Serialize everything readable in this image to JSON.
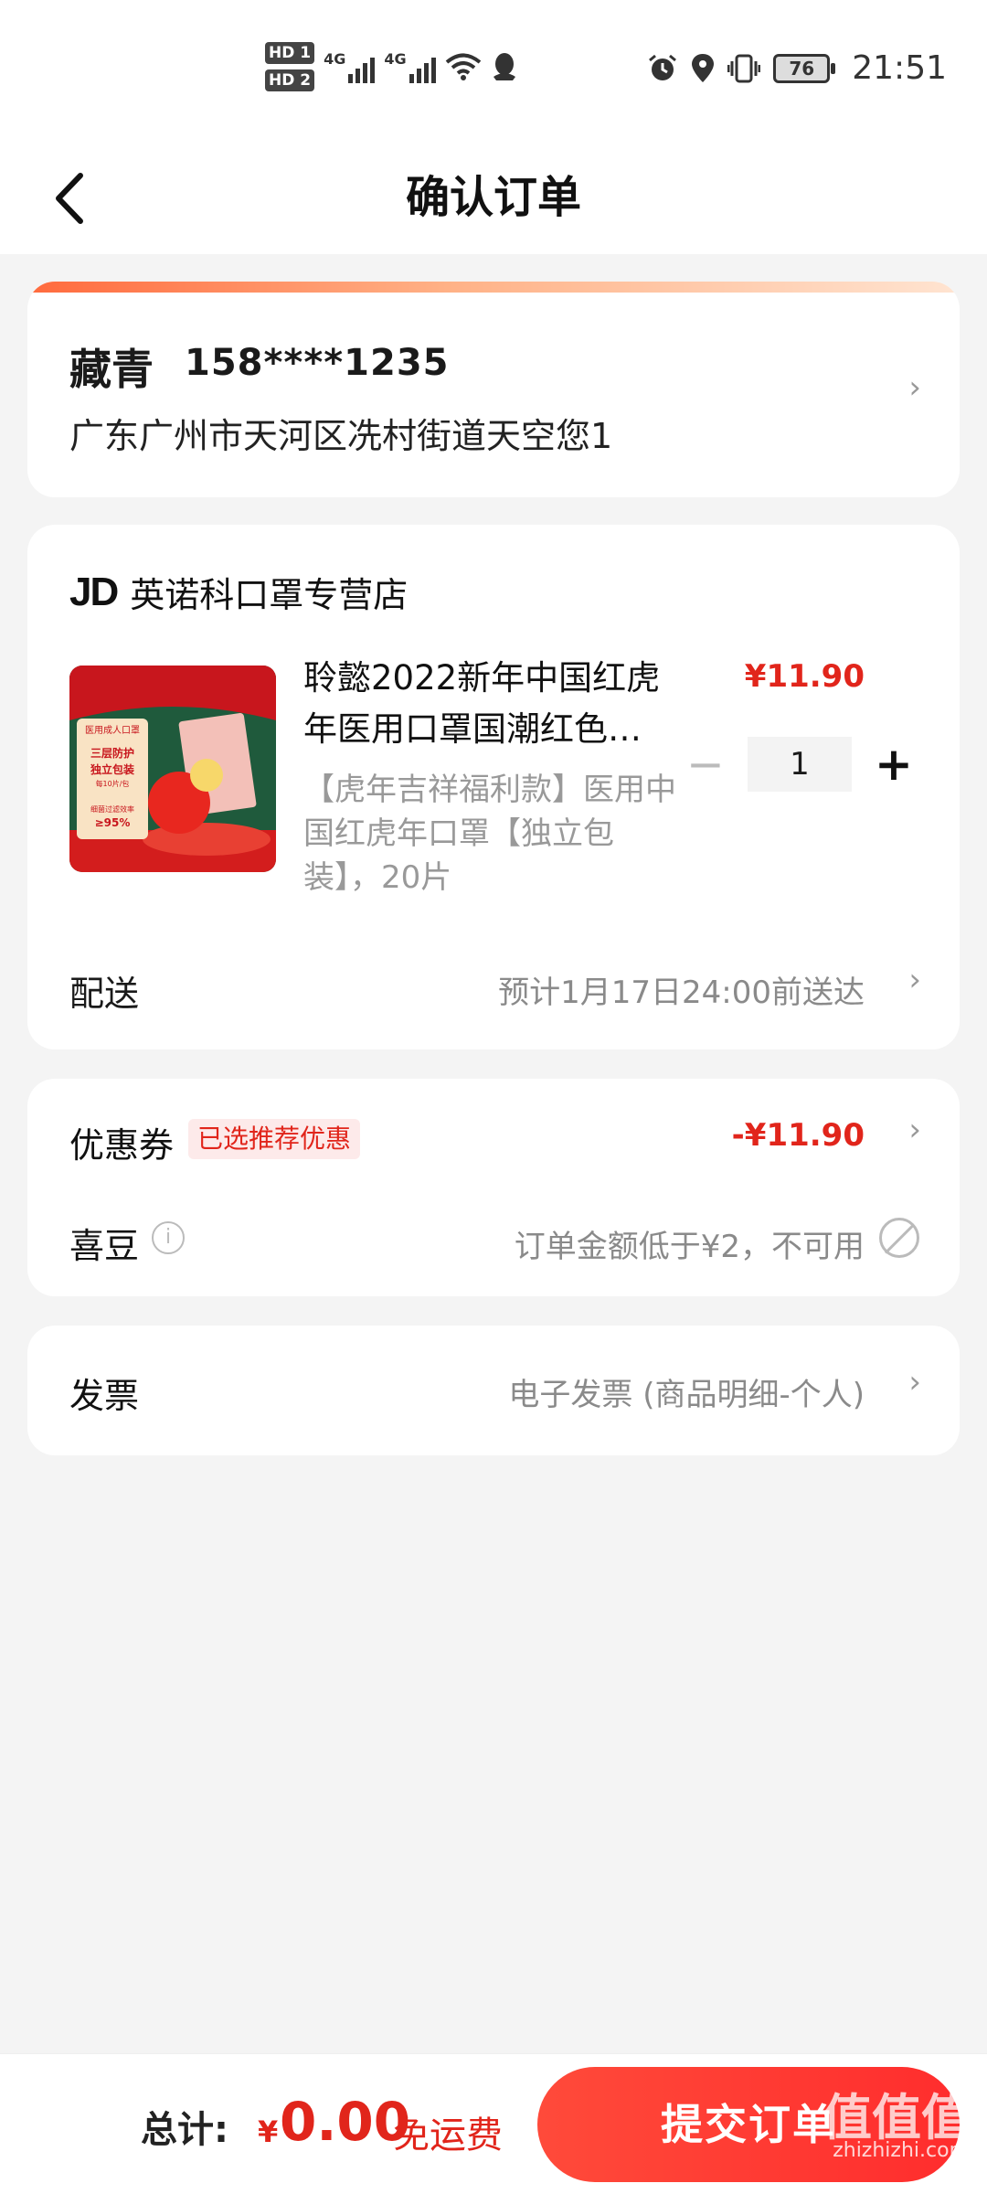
{
  "status_bar": {
    "sim1": "HD 1",
    "sim2": "HD 2",
    "net1": "4G",
    "net2": "4G",
    "battery": "76",
    "time": "21:51"
  },
  "header": {
    "title": "确认订单"
  },
  "address": {
    "name": "藏青",
    "phone": "158****1235",
    "detail": "广东广州市天河区冼村街道天空您1"
  },
  "store": {
    "logo": "JD",
    "name": "英诺科口罩专营店"
  },
  "product": {
    "name_line1": "聆懿2022新年中国红虎",
    "name_line2": "年医用口罩国潮红色…",
    "desc": "【虎年吉祥福利款】医用中国红虎年口罩【独立包装】，20片",
    "price": "¥11.90",
    "quantity": "1",
    "thumb_text1": "医用成人口罩",
    "thumb_text2": "三层防护",
    "thumb_text3": "独立包装",
    "thumb_text4": "每10片/包",
    "thumb_text5": "细菌过滤效率",
    "thumb_text6": "≥95%"
  },
  "shipping": {
    "label": "配送",
    "value": "预计1月17日24:00前送达"
  },
  "coupon": {
    "label": "优惠券",
    "badge": "已选推荐优惠",
    "value": "-¥11.90"
  },
  "beans": {
    "label": "喜豆",
    "info": "i",
    "value": "订单金额低于¥2，不可用"
  },
  "invoice": {
    "label": "发票",
    "value": "电子发票 (商品明细-个人)"
  },
  "footer": {
    "total_label": "总计:",
    "currency": "¥",
    "total_amount": "0.00",
    "free_shipping": "免运费",
    "submit_label": "提交订单",
    "watermark_logo": "值值值",
    "watermark_text": "zhizhizhi.com"
  },
  "colors": {
    "accent": "#e1251b",
    "submit": "#ff3b30",
    "muted": "#8a8a8a"
  }
}
